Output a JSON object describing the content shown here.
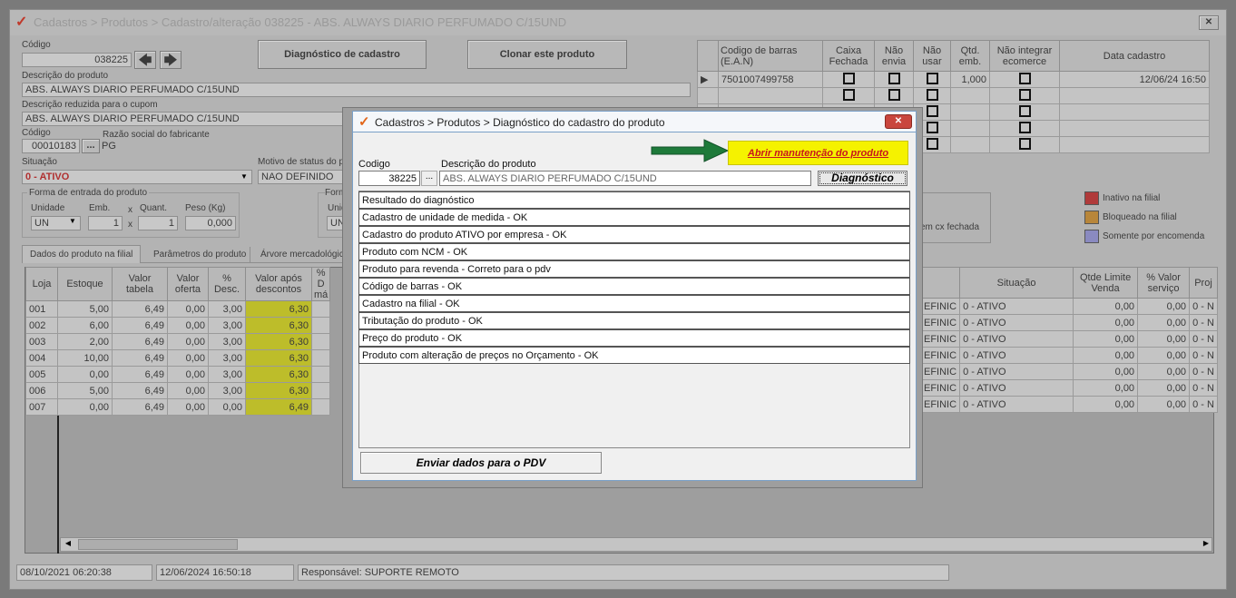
{
  "window": {
    "title": "Cadastros > Produtos > Cadastro/alteração  038225 - ABS. ALWAYS DIARIO PERFUMADO C/15UND"
  },
  "form": {
    "codigo_label": "Código",
    "codigo_value": "038225",
    "diag_button": "Diagnóstico de cadastro",
    "clone_button": "Clonar este produto",
    "desc_label": "Descrição  do produto",
    "desc_value": "ABS. ALWAYS DIARIO PERFUMADO C/15UND",
    "desc_red_label": "Descrição reduzida para o cupom",
    "desc_red_value": "ABS. ALWAYS DIARIO PERFUMADO C/15UND",
    "fab_code_label": "Código",
    "fab_code_value": "00010183",
    "fab_label": "Razão social do fabricante",
    "fab_value": "PG",
    "situacao_label": "Situação",
    "situacao_value": "0 - ATIVO",
    "motivo_label": "Motivo de status do pr",
    "motivo_value": "NAO DEFINIDO",
    "entrada_label": "Forma de entrada do produto",
    "unidade_label": "Unidade",
    "unidade_value": "UN",
    "emb_label": "Emb.",
    "emb_value": "1",
    "x1": "x",
    "quant_label": "Quant.",
    "quant_value": "1",
    "x2": "x",
    "peso_label": "Peso (Kg)",
    "peso_value": "0,000",
    "forma2_label": "Forma",
    "unidade2_label": "Unida",
    "unidade2_value": "UN",
    "cxfechada_text": "em cx fechada"
  },
  "tabs": [
    "Dados do produto na filial",
    "Parâmetros do produto",
    "Árvore mercadológic"
  ],
  "barcode_table": {
    "headers": [
      "Codigo de barras (E.A.N)",
      "Caixa Fechada",
      "Não envia",
      "Não usar",
      "Qtd. emb.",
      "Não integrar ecomerce",
      "Data cadastro"
    ],
    "row": {
      "ean": "7501007499758",
      "qtd": "1,000",
      "data": "12/06/24 16:50"
    }
  },
  "legend": [
    {
      "label": "Inativo na filial",
      "color": "#b03a3a"
    },
    {
      "label": "Bloqueado na filial",
      "color": "#b8863a"
    },
    {
      "label": "Somente por encomenda",
      "color": "#8a8ac0"
    }
  ],
  "stock": {
    "headers": [
      "Loja",
      "Estoque",
      "Valor tabela",
      "Valor oferta",
      "% Desc.",
      "Valor após descontos",
      "% D má"
    ],
    "rows": [
      [
        "001",
        "5,00",
        "6,49",
        "0,00",
        "3,00",
        "6,30"
      ],
      [
        "002",
        "6,00",
        "6,49",
        "0,00",
        "3,00",
        "6,30"
      ],
      [
        "003",
        "2,00",
        "6,49",
        "0,00",
        "3,00",
        "6,30"
      ],
      [
        "004",
        "10,00",
        "6,49",
        "0,00",
        "3,00",
        "6,30"
      ],
      [
        "005",
        "0,00",
        "6,49",
        "0,00",
        "3,00",
        "6,30"
      ],
      [
        "006",
        "5,00",
        "6,49",
        "0,00",
        "3,00",
        "6,30"
      ],
      [
        "007",
        "0,00",
        "6,49",
        "0,00",
        "0,00",
        "6,49"
      ]
    ]
  },
  "stock_right": {
    "headers": [
      "Situação",
      "Qtde Limite Venda",
      "% Valor serviço",
      "Proj"
    ],
    "rows": [
      [
        "EFINIC",
        "0 - ATIVO",
        "0,00",
        "0,00",
        "0 - N"
      ],
      [
        "EFINIC",
        "0 - ATIVO",
        "0,00",
        "0,00",
        "0 - N"
      ],
      [
        "EFINIC",
        "0 - ATIVO",
        "0,00",
        "0,00",
        "0 - N"
      ],
      [
        "EFINIC",
        "0 - ATIVO",
        "0,00",
        "0,00",
        "0 - N"
      ],
      [
        "EFINIC",
        "0 - ATIVO",
        "0,00",
        "0,00",
        "0 - N"
      ],
      [
        "EFINIC",
        "0 - ATIVO",
        "0,00",
        "0,00",
        "0 - N"
      ],
      [
        "EFINIC",
        "0 - ATIVO",
        "0,00",
        "0,00",
        "0 - N"
      ]
    ]
  },
  "status": {
    "created": "08/10/2021 06:20:38",
    "updated": "12/06/2024 16:50:18",
    "responsavel": "Responsável: SUPORTE REMOTO"
  },
  "dialog": {
    "title": "Cadastros > Produtos > Diagnóstico do cadastro do produto",
    "abrir_button": "Abrir manutenção do produto",
    "codigo_label": "Codigo",
    "codigo_value": "38225",
    "dots": "...",
    "desc_label": "Descrição do produto",
    "desc_value": "ABS. ALWAYS DIARIO PERFUMADO C/15UND",
    "diag_button": "Diagnóstico",
    "results": [
      "Resultado do diagnóstico",
      "Cadastro de unidade de medida - OK",
      "Cadastro do produto ATIVO por empresa - OK",
      "Produto com NCM - OK",
      "Produto para revenda - Correto para o pdv",
      "Código de barras - OK",
      "Cadastro na filial - OK",
      "Tributação do produto - OK",
      "Preço do produto - OK",
      "Produto com alteração de preços no Orçamento - OK"
    ],
    "enviar_button": "Enviar dados para o PDV"
  }
}
